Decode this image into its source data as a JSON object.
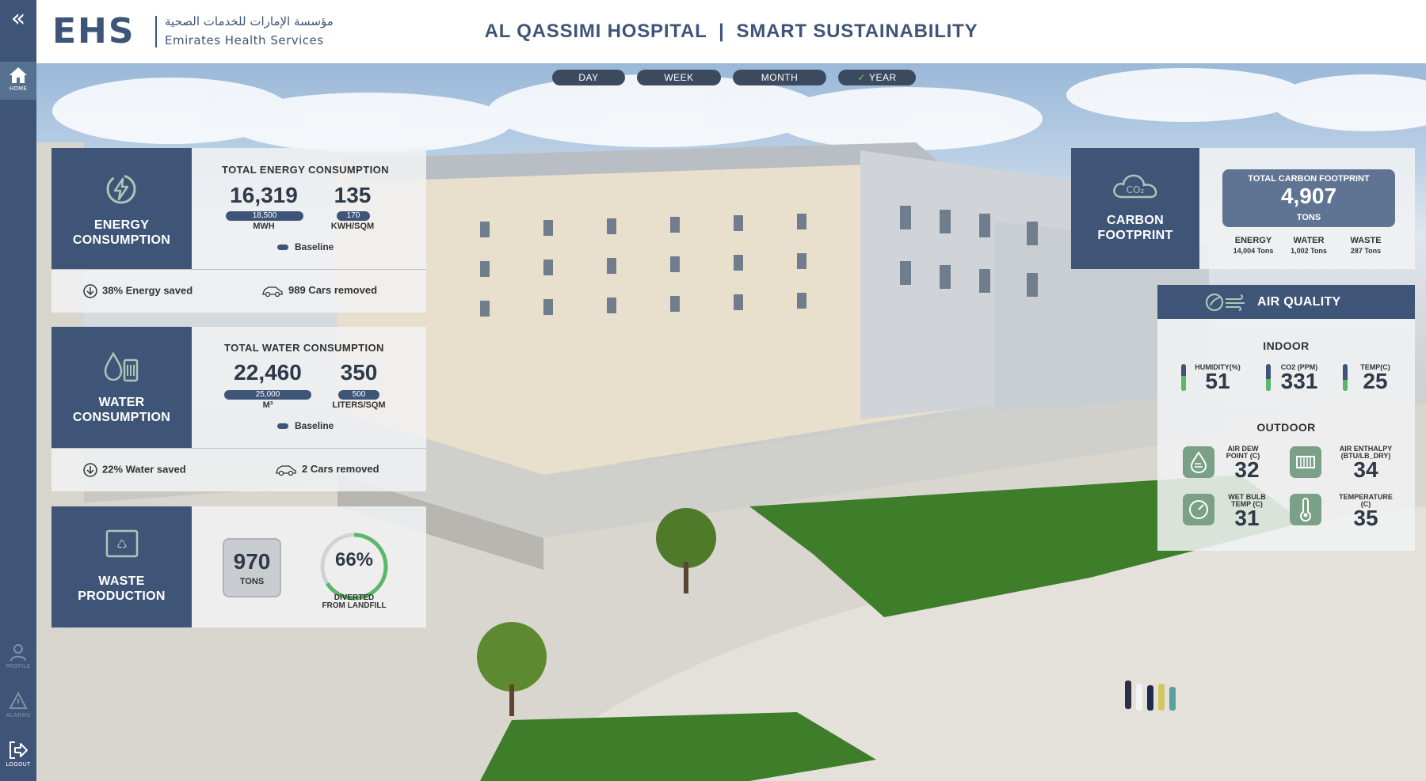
{
  "sidebar": {
    "collapse_icon": "double-chevron-left-icon",
    "home_label": "HOME",
    "profile_label": "PROFILE",
    "alarms_label": "ALARMS",
    "logout_label": "LOGOUT"
  },
  "header": {
    "logo_mark": "EHS",
    "logo_arabic": "مؤسسة الإمارات للخدمات الصحية",
    "logo_english": "Emirates Health Services",
    "title": "AL QASSIMI HOSPITAL  |  SMART SUSTAINABILITY"
  },
  "tabs": [
    {
      "label": "DAY",
      "selected": false
    },
    {
      "label": "WEEK",
      "selected": false
    },
    {
      "label": "MONTH",
      "selected": false
    },
    {
      "label": "YEAR",
      "selected": true,
      "check": "✓"
    }
  ],
  "energy": {
    "heading_line1": "ENERGY",
    "heading_line2": "CONSUMPTION",
    "title": "TOTAL ENERGY CONSUMPTION",
    "value1": "16,319",
    "baseline1": "18,500",
    "unit1": "MWH",
    "value2": "135",
    "baseline2": "170",
    "unit2": "KWH/SQM",
    "baseline_label": "Baseline",
    "saved": "38% Energy saved",
    "cars": "989 Cars removed"
  },
  "water": {
    "heading_line1": "WATER",
    "heading_line2": "CONSUMPTION",
    "title": "TOTAL WATER CONSUMPTION",
    "value1": "22,460",
    "baseline1": "25,000",
    "unit1": "M³",
    "value2": "350",
    "baseline2": "500",
    "unit2": "LITERS/SQM",
    "baseline_label": "Baseline",
    "saved": "22% Water saved",
    "cars": "2 Cars removed"
  },
  "waste": {
    "heading_line1": "WASTE",
    "heading_line2": "PRODUCTION",
    "tons_value": "970",
    "tons_unit": "TONS",
    "diverted_value": "66%",
    "diverted_percent": 66,
    "diverted_line1": "DIVERTED",
    "diverted_line2": "FROM LANDFILL"
  },
  "carbon": {
    "heading_line1": "CARBON",
    "heading_line2": "FOOTPRINT",
    "icon_text": "CO₂",
    "total_title": "TOTAL CARBON FOOTPRINT",
    "total_value": "4,907",
    "total_unit": "TONS",
    "energy_label": "ENERGY",
    "energy_value": "14,004 Tons",
    "water_label": "WATER",
    "water_value": "1,002 Tons",
    "waste_label": "WASTE",
    "waste_value": "287 Tons"
  },
  "air": {
    "title": "AIR QUALITY",
    "indoor_title": "INDOOR",
    "humidity_label": "HUMIDITY(%)",
    "humidity_value": "51",
    "humidity_level": 0.55,
    "co2_label": "CO2 (PPM)",
    "co2_value": "331",
    "co2_level": 0.45,
    "temp_label": "TEMP(C)",
    "temp_value": "25",
    "temp_level": 0.4,
    "outdoor_title": "OUTDOOR",
    "dew_label1": "AIR DEW",
    "dew_label2": "POINT (C)",
    "dew_value": "32",
    "enthalpy_label1": "AIR ENTHALPY",
    "enthalpy_label2": "(BTU/LB_DRY)",
    "enthalpy_value": "34",
    "wetbulb_label1": "WET BULB",
    "wetbulb_label2": "TEMP (C)",
    "wetbulb_value": "31",
    "temperature_label1": "TEMPERATURE",
    "temperature_label2": "(C)",
    "temperature_value": "35"
  },
  "colors": {
    "brand_navy": "#3f5578",
    "panel_bg": "#f0f1f2",
    "accent_green": "#5bb86a",
    "icon_green": "#7aa088"
  }
}
